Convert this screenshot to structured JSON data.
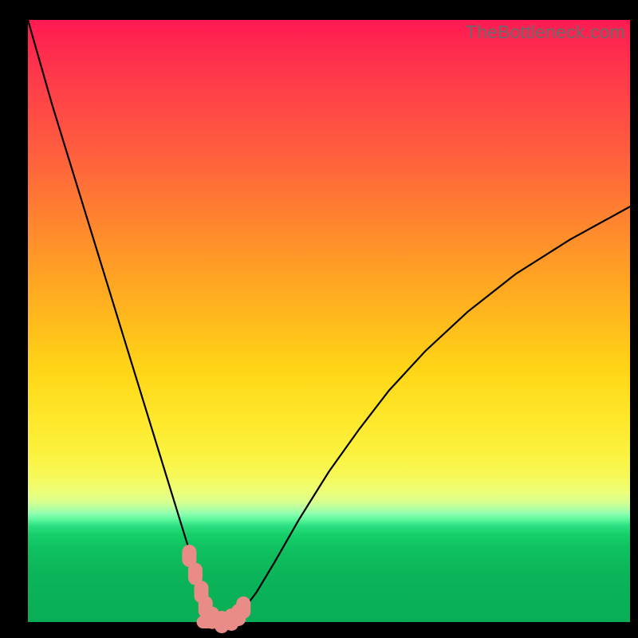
{
  "watermark": "TheBottleneck.com",
  "chart_data": {
    "type": "line",
    "title": "",
    "xlabel": "",
    "ylabel": "",
    "xlim": [
      0,
      100
    ],
    "ylim": [
      0,
      100
    ],
    "x": [
      0,
      2,
      4,
      6,
      8,
      10,
      12,
      14,
      16,
      18,
      20,
      22,
      24,
      26,
      27,
      28,
      29,
      30,
      31,
      32,
      33,
      34,
      35,
      38,
      41,
      45,
      50,
      55,
      60,
      66,
      73,
      81,
      90,
      100
    ],
    "y": [
      100,
      93,
      86,
      79.5,
      73,
      66.5,
      60,
      53.5,
      47,
      40.5,
      34,
      27.5,
      21,
      14.5,
      11.3,
      8.2,
      5.2,
      2.6,
      1.0,
      0.2,
      0.0,
      0.2,
      1.0,
      5.0,
      10.0,
      17.0,
      25.0,
      32.0,
      38.5,
      45.0,
      51.5,
      57.8,
      63.5,
      69.0
    ],
    "markers": {
      "x": [
        26.8,
        27.8,
        28.8,
        29.5,
        30.6,
        32.2,
        33.8,
        35.0,
        35.8
      ],
      "y": [
        11.0,
        8.0,
        5.0,
        2.5,
        0.7,
        0.0,
        0.4,
        1.2,
        2.4
      ]
    },
    "note": "V-shaped curve with vertex near x≈32 at y≈0; pink markers cluster around the trough. Background gradient (red→green) conveys a secondary value axis but has no numeric labels."
  }
}
